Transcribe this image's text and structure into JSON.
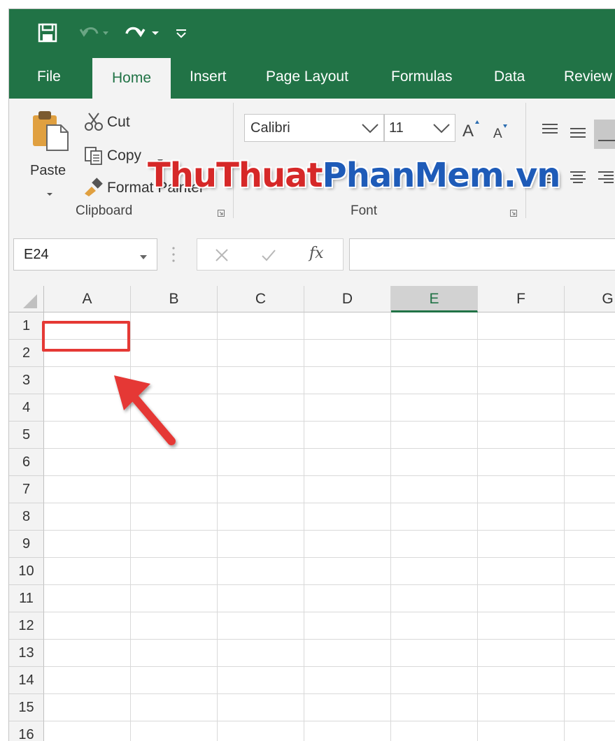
{
  "colors": {
    "excel_green": "#217346",
    "ribbon_bg": "#f3f3f3",
    "highlight_red": "#e53935"
  },
  "qat": {
    "icons": [
      "save-icon",
      "undo-icon",
      "redo-icon",
      "customize-qat-icon"
    ]
  },
  "tabs": [
    {
      "label": "File",
      "active": false
    },
    {
      "label": "Home",
      "active": true
    },
    {
      "label": "Insert",
      "active": false
    },
    {
      "label": "Page Layout",
      "active": false
    },
    {
      "label": "Formulas",
      "active": false
    },
    {
      "label": "Data",
      "active": false
    },
    {
      "label": "Review",
      "active": false
    }
  ],
  "clipboard": {
    "paste_label": "Paste",
    "cut_label": "Cut",
    "copy_label": "Copy",
    "format_painter_label": "Format Painter",
    "group_label": "Clipboard"
  },
  "font": {
    "font_name": "Calibri",
    "font_size": "11",
    "group_label": "Font"
  },
  "formula_bar": {
    "name_box": "E24",
    "fx_label": "fx",
    "formula_value": ""
  },
  "sheet": {
    "columns": [
      "A",
      "B",
      "C",
      "D",
      "E",
      "F",
      "G"
    ],
    "selected_column": "E",
    "rows": [
      "1",
      "2",
      "3",
      "4",
      "5",
      "6",
      "7",
      "8",
      "9",
      "10",
      "11",
      "12",
      "13",
      "14",
      "15",
      "16"
    ],
    "highlighted_cell": "A1"
  },
  "watermark": {
    "part1": "ThuThuat",
    "part2": "PhanMem",
    "part3": ".vn"
  }
}
